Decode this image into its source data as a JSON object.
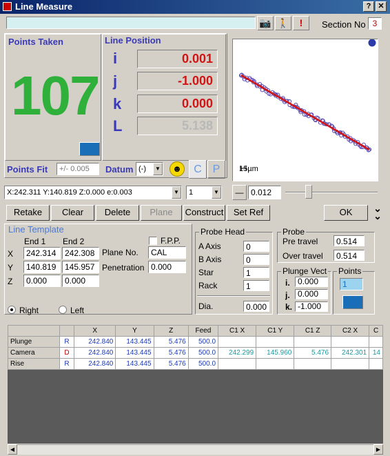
{
  "window": {
    "title": "Line Measure",
    "help_label": "?",
    "close_label": "✕"
  },
  "toolbar": {
    "section_label": "Section No",
    "section_value": "3"
  },
  "points_taken": {
    "label": "Points Taken",
    "count": "107"
  },
  "line_position": {
    "label": "Line Position",
    "i_label": "i",
    "i_value": "0.001",
    "j_label": "j",
    "j_value": "-1.000",
    "k_label": "k",
    "k_value": "0.000",
    "L_label": "L",
    "L_value": "5.138"
  },
  "plot": {
    "scale_label": "15µm"
  },
  "points_fit": {
    "label": "Points Fit",
    "value": "+/- 0.005"
  },
  "datum": {
    "label": "Datum",
    "value": "(-)",
    "c_label": "C",
    "p_label": "P"
  },
  "status": {
    "position": "X:242.311 Y:140.819 Z:0.000 e:0.003",
    "count": "1",
    "tolerance": "0.012"
  },
  "buttons": {
    "retake": "Retake",
    "clear": "Clear",
    "delete": "Delete",
    "plane": "Plane",
    "construct": "Construct",
    "set_ref": "Set Ref",
    "ok": "OK"
  },
  "template": {
    "title": "Line Template",
    "end1": "End 1",
    "end2": "End 2",
    "x_label": "X",
    "y_label": "Y",
    "z_label": "Z",
    "x1": "242.314",
    "x2": "242.308",
    "y1": "140.819",
    "y2": "145.957",
    "z1": "0.000",
    "z2": "0.000",
    "fps_label": "F.P.P.",
    "plane_label": "Plane No.",
    "plane_value": "CAL",
    "penetration_label": "Penetration",
    "penetration_value": "0.000",
    "right_label": "Right",
    "left_label": "Left"
  },
  "probe_head": {
    "title": "Probe Head",
    "a_label": "A Axis",
    "a_value": "0",
    "b_label": "B Axis",
    "b_value": "0",
    "star_label": "Star",
    "star_value": "1",
    "rack_label": "Rack",
    "rack_value": "1",
    "dia_label": "Dia.",
    "dia_value": "0.000"
  },
  "probe": {
    "title": "Probe",
    "pre_label": "Pre travel",
    "pre_value": "0.514",
    "over_label": "Over travel",
    "over_value": "0.514"
  },
  "plunge": {
    "title": "Plunge Vect",
    "i_label": "i.",
    "i_value": "0.000",
    "j_label": "j.",
    "j_value": "0.000",
    "k_label": "k.",
    "k_value": "-1.000"
  },
  "points": {
    "title": "Points",
    "value": "1"
  },
  "grid": {
    "headers": [
      "",
      "",
      "X",
      "Y",
      "Z",
      "Feed",
      "C1 X",
      "C1 Y",
      "C1 Z",
      "C2 X",
      "C"
    ],
    "rows": [
      [
        "Plunge",
        "R",
        "242.840",
        "143.445",
        "5.476",
        "500.0",
        "",
        "",
        "",
        "",
        ""
      ],
      [
        "Camera",
        "D",
        "242.840",
        "143.445",
        "5.476",
        "500.0",
        "242.299",
        "145.960",
        "5.476",
        "242.301",
        "14"
      ],
      [
        "Rise",
        "R",
        "242.840",
        "143.445",
        "5.476",
        "500.0",
        "",
        "",
        "",
        "",
        ""
      ]
    ]
  }
}
